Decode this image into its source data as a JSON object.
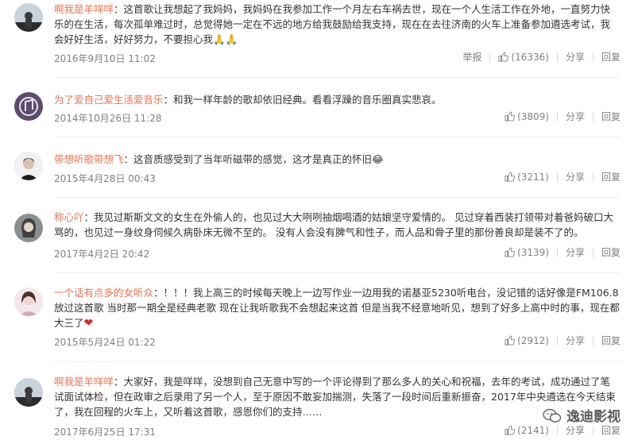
{
  "comments": [
    {
      "author": "啊我是羊咩咩",
      "text": "：这首歌让我想起了我妈妈，我妈妈在我参加工作一个月左右车祸去世，现在一个人生活工作在外地，一直努力快乐的在生活，每次孤单难过时，总觉得她一定在不远的地方给我鼓励给我支持，现在在去往济南的火车上准备参加遴选考试，我会好好生活，好好努力，不要担心我🙏🙏",
      "date": "2016年9月10日 11:02",
      "report": "举报",
      "likes": "(16336)",
      "share": "分享",
      "reply": "回复"
    },
    {
      "author": "为了爱自己爱生活爱音乐",
      "text": "：和我一样年龄的歌却依旧经典。看看浮躁的音乐圈真实悲哀。",
      "date": "2014年10月26日 11:28",
      "likes": "(3809)",
      "share": "分享",
      "reply": "回复"
    },
    {
      "author": "带想听歌带想飞",
      "text": "：这音质感受到了当年听磁带的感觉，这才是真正的怀旧😂",
      "date": "2015年4月28日 00:43",
      "likes": "(3211)",
      "share": "分享",
      "reply": "回复"
    },
    {
      "author": "称心吖",
      "text": "：我见过斯斯文文的女生在外偷人的，也见过大大咧咧抽烟喝酒的姑娘坚守爱情的。 见过穿着西装打领带对着爸妈破口大骂的，也见过一身纹身伺候久病卧床无微不至的。 没有人会没有脾气和性子，而人品和骨子里的那份善良却是装不了的。",
      "date": "2017年4月2日 20:42",
      "likes": "(3139)",
      "share": "分享",
      "reply": "回复"
    },
    {
      "author": "一个话有点多的女听众",
      "text": "：！！！我上高三的时候每天晚上一边写作业一边用我的诺基亚5230听电台，没记错的话好像是FM106.8放过这首歌 当时那一期全是经典老歌 现在让我听歌我不会想起来这首 但是当我不经意地听见，想到了好多上高中时的事，现在都大三了",
      "heart": "❤",
      "date": "2015年5月24日 01:22",
      "likes": "(2912)",
      "share": "分享",
      "reply": "回复"
    },
    {
      "author": "啊我是羊咩咩",
      "text": "：大家好，我是咩咩，没想到自己无意中写的一个评论得到了那么多人的关心和祝福，去年的考试，成功通过了笔试面试体检，但在政审之后录用了另一个人，至于原因不敢妄加揣测，失落了一段时间后重新振奋，2017年中央遴选在今天结束了，我在回程的火车上，又听着这首歌，感恩你们的支持……",
      "date": "2017年6月25日 17:31",
      "likes": "(2141)",
      "share": "分享",
      "reply": "回复"
    }
  ],
  "watermark": {
    "text": "逸迪影视"
  },
  "icons": [
    "avatar-icon",
    "thumb-up-icon",
    "heart-icon",
    "watermark-logo-icon"
  ],
  "colors": {
    "author": "#eb7350",
    "meta": "#808080",
    "text": "#333333",
    "heart": "#e2262a"
  }
}
